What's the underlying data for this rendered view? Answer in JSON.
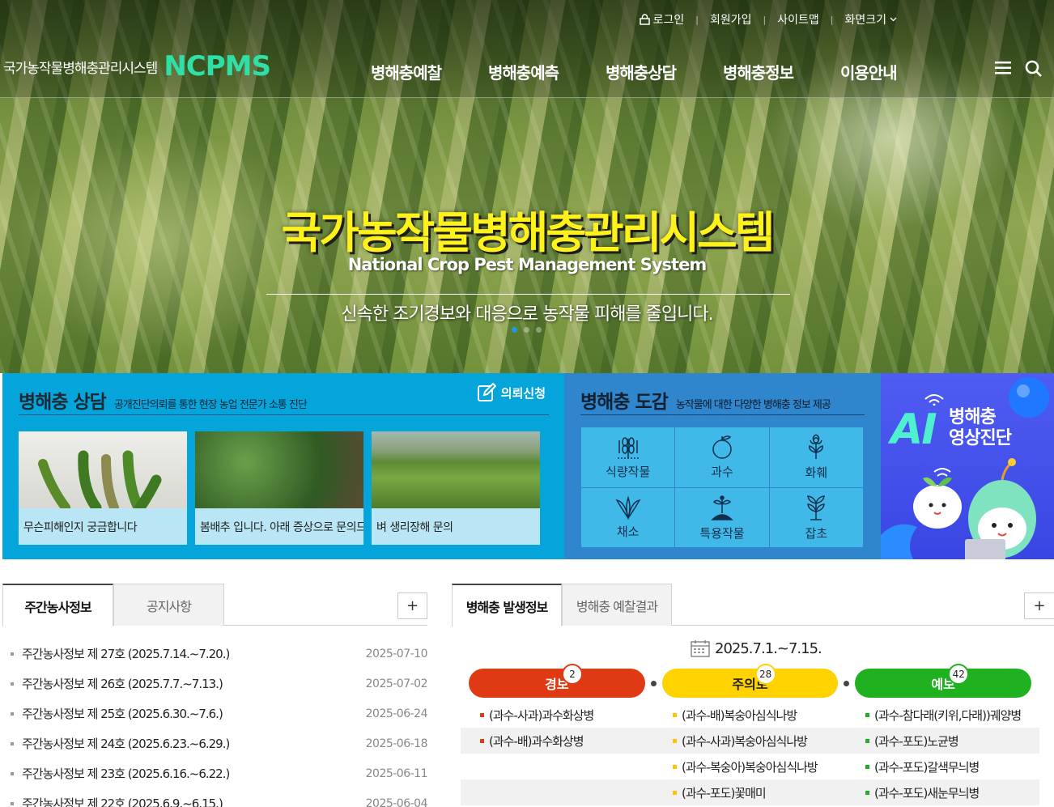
{
  "header": {
    "util": {
      "login": "로그인",
      "signup": "회원가입",
      "sitemap": "사이트맵",
      "screen_size": "화면크기"
    },
    "brand": {
      "kr": "국가농작물병해충관리시스템",
      "en": "NCPMS"
    },
    "gnb": [
      "병해충예찰",
      "병해충예측",
      "병해충상담",
      "병해충정보",
      "이용안내"
    ]
  },
  "hero": {
    "title": "국가농작물병해충관리시스템",
    "subtitle": "National Crop Pest Management System",
    "desc": "신속한 조기경보와 대응으로 농작물 피해를 줄입니다."
  },
  "consult": {
    "title": "병해충 상담",
    "desc": "공개진단의뢰를 통한 현장 농업 전문가 소통 진단",
    "request_label": "의뢰신청",
    "cards": [
      {
        "caption": "무슨피해인지 궁금합니다"
      },
      {
        "caption": "봄배추 입니다. 아래 증상으로 문의드립니다"
      },
      {
        "caption": "벼 생리장해 문의"
      }
    ]
  },
  "encyclopedia": {
    "title": "병해충 도감",
    "desc": "농작물에 대한 다양한 병해충 정보 제공",
    "items": [
      {
        "label": "식량작물",
        "icon": "grain-icon"
      },
      {
        "label": "과수",
        "icon": "fruit-icon"
      },
      {
        "label": "화훼",
        "icon": "flower-icon"
      },
      {
        "label": "채소",
        "icon": "vegetable-icon"
      },
      {
        "label": "특용작물",
        "icon": "special-crop-icon"
      },
      {
        "label": "잡초",
        "icon": "weed-icon"
      }
    ]
  },
  "ai_banner": {
    "ai": "AI",
    "line1": "병해충",
    "line2": "영상진단"
  },
  "board_left": {
    "tabs": [
      "주간농사정보",
      "공지사항"
    ],
    "more": "+",
    "rows": [
      {
        "title": "주간농사정보 제 27호 (2025.7.14.~7.20.)",
        "date": "2025-07-10"
      },
      {
        "title": "주간농사정보 제 26호 (2025.7.7.~7.13.)",
        "date": "2025-07-02"
      },
      {
        "title": "주간농사정보 제 25호 (2025.6.30.~7.6.)",
        "date": "2025-06-24"
      },
      {
        "title": "주간농사정보 제 24호 (2025.6.23.~6.29.)",
        "date": "2025-06-18"
      },
      {
        "title": "주간농사정보 제 23호 (2025.6.16.~6.22.)",
        "date": "2025-06-11"
      },
      {
        "title": "주간농사정보 제 22호 (2025.6.9.~6.15.)",
        "date": "2025-06-04"
      }
    ]
  },
  "board_right": {
    "tabs": [
      "병해충 발생정보",
      "병해충 예찰결과"
    ],
    "more": "+",
    "period": "2025.7.1.~7.15.",
    "levels": [
      {
        "label": "경보",
        "count": "2",
        "color": "#e03a14"
      },
      {
        "label": "주의보",
        "count": "28",
        "color": "#ffd200"
      },
      {
        "label": "예보",
        "count": "42",
        "color": "#1fb11f"
      }
    ],
    "warning": [
      "(과수-사과)과수화상병",
      "(과수-배)과수화상병"
    ],
    "advisory": [
      "(과수-배)복숭아심식나방",
      "(과수-사과)복숭아심식나방",
      "(과수-복숭아)복숭아심식나방",
      "(과수-포도)꽃매미"
    ],
    "forecast": [
      "(과수-참다래(키위,다래))궤양병",
      "(과수-포도)노균병",
      "(과수-포도)갈색무늬병",
      "(과수-포도)새눈무늬병"
    ]
  }
}
